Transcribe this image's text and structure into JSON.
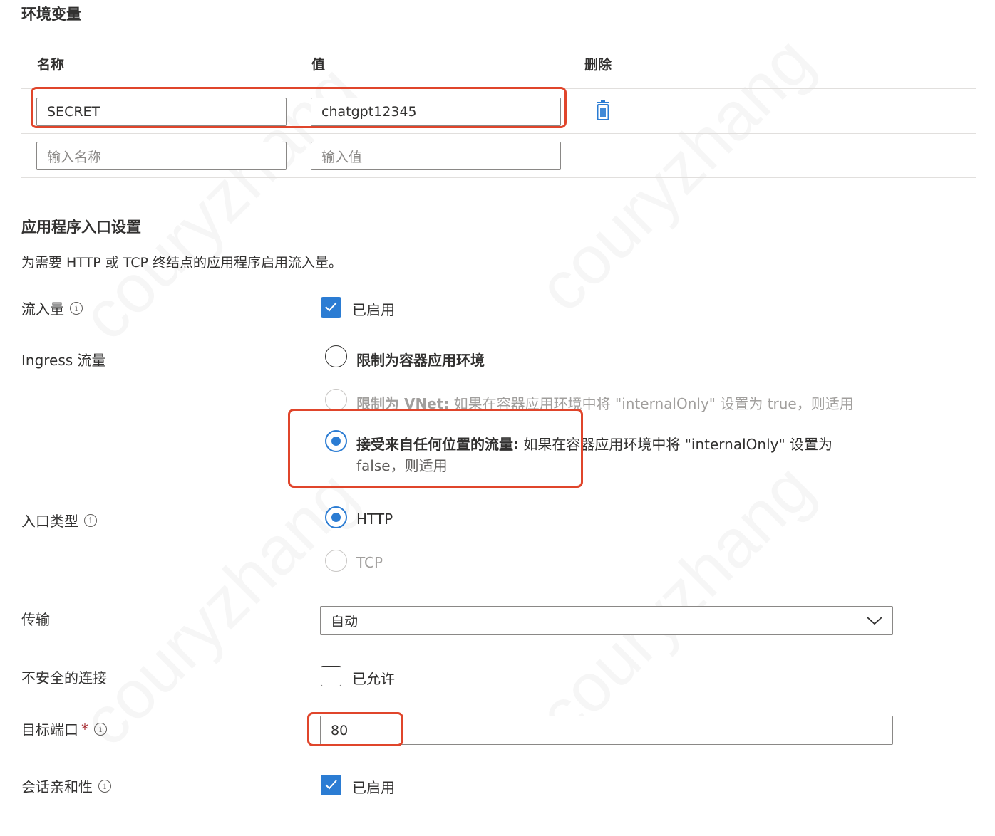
{
  "env_section": {
    "title": "环境变量",
    "columns": {
      "name": "名称",
      "value": "值",
      "delete": "删除"
    },
    "rows": [
      {
        "name": "SECRET",
        "value": "chatgpt12345"
      }
    ],
    "new_row": {
      "name_placeholder": "输入名称",
      "value_placeholder": "输入值"
    },
    "delete_icon": "trash-icon"
  },
  "ingress_section": {
    "title": "应用程序入口设置",
    "description": "为需要 HTTP 或 TCP 终结点的应用程序启用流入量。",
    "ingress": {
      "label": "流入量",
      "checkbox_label": "已启用",
      "checked": true
    },
    "traffic": {
      "label": "Ingress 流量",
      "options": [
        {
          "bold": "限制为容器应用环境",
          "text": "",
          "selected": false,
          "disabled": false
        },
        {
          "bold": "限制为 VNet:",
          "text": " 如果在容器应用环境中将 \"internalOnly\" 设置为 true，则适用",
          "selected": false,
          "disabled": true
        },
        {
          "bold": "接受来自任何位置的流量:",
          "text": " 如果在容器应用环境中将 \"internalOnly\" 设置为",
          "text2": "false，则适用",
          "selected": true,
          "disabled": false
        }
      ]
    },
    "ingress_type": {
      "label": "入口类型",
      "options": [
        {
          "text": "HTTP",
          "selected": true,
          "disabled": false
        },
        {
          "text": "TCP",
          "selected": false,
          "disabled": true
        }
      ]
    },
    "transport": {
      "label": "传输",
      "value": "自动"
    },
    "insecure": {
      "label": "不安全的连接",
      "checkbox_label": "已允许",
      "checked": false
    },
    "target_port": {
      "label": "目标端口",
      "required_mark": "*",
      "value": "80"
    },
    "session_affinity": {
      "label": "会话亲和性",
      "checkbox_label": "已启用",
      "checked": true
    }
  },
  "watermark_text": "couryzhang",
  "colors": {
    "accent": "#2b7cd3",
    "highlight": "#e0452b"
  }
}
